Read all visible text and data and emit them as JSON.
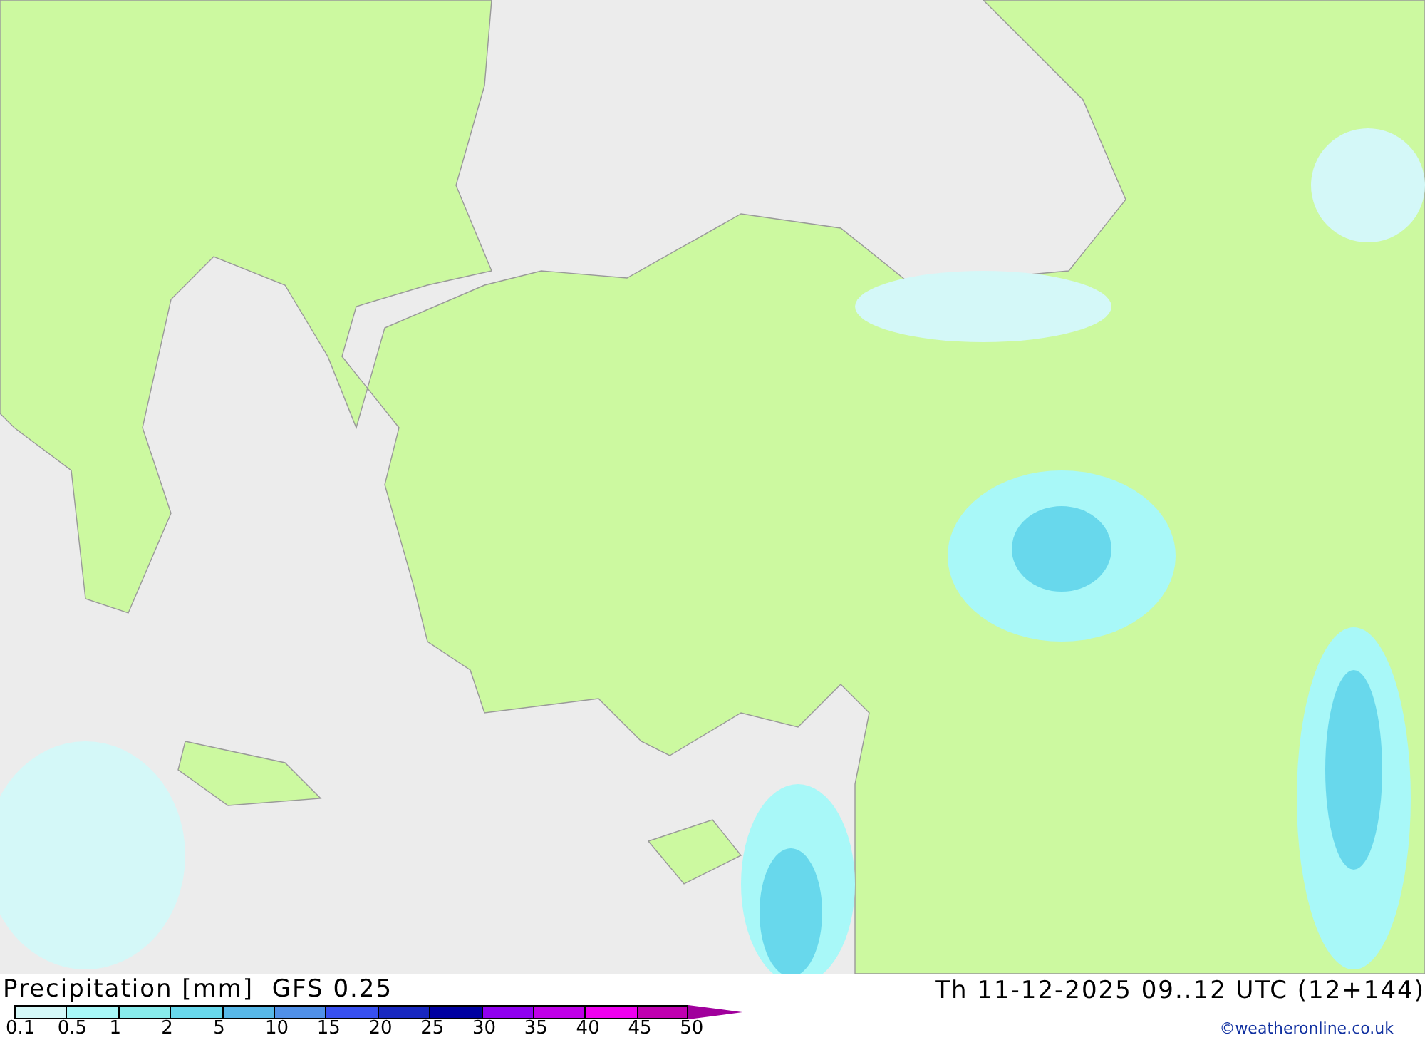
{
  "map": {
    "title": "Precipitation [mm]",
    "model": "GFS 0.25",
    "valid_time": "Th 11-12-2025 09..12 UTC (12+144)"
  },
  "legend": [
    {
      "label": "0.1",
      "color": "#d4f8f8",
      "kind": "cell"
    },
    {
      "label": "0.5",
      "color": "#a8f8f8",
      "kind": "cell"
    },
    {
      "label": "1",
      "color": "#88ecec",
      "kind": "cell"
    },
    {
      "label": "2",
      "color": "#68d8ec",
      "kind": "cell"
    },
    {
      "label": "5",
      "color": "#58b8e8",
      "kind": "cell"
    },
    {
      "label": "10",
      "color": "#5090e8",
      "kind": "cell"
    },
    {
      "label": "15",
      "color": "#3850f0",
      "kind": "cell"
    },
    {
      "label": "20",
      "color": "#1828c0",
      "kind": "cell"
    },
    {
      "label": "25",
      "color": "#0000a0",
      "kind": "cell"
    },
    {
      "label": "30",
      "color": "#9000f0",
      "kind": "cell"
    },
    {
      "label": "35",
      "color": "#c000e8",
      "kind": "cell"
    },
    {
      "label": "40",
      "color": "#f000f0",
      "kind": "cell"
    },
    {
      "label": "45",
      "color": "#c000b0",
      "kind": "cell"
    },
    {
      "label": "50",
      "color": "#a0009c",
      "kind": "arrow"
    }
  ],
  "credit": "©weatheronline.co.uk"
}
